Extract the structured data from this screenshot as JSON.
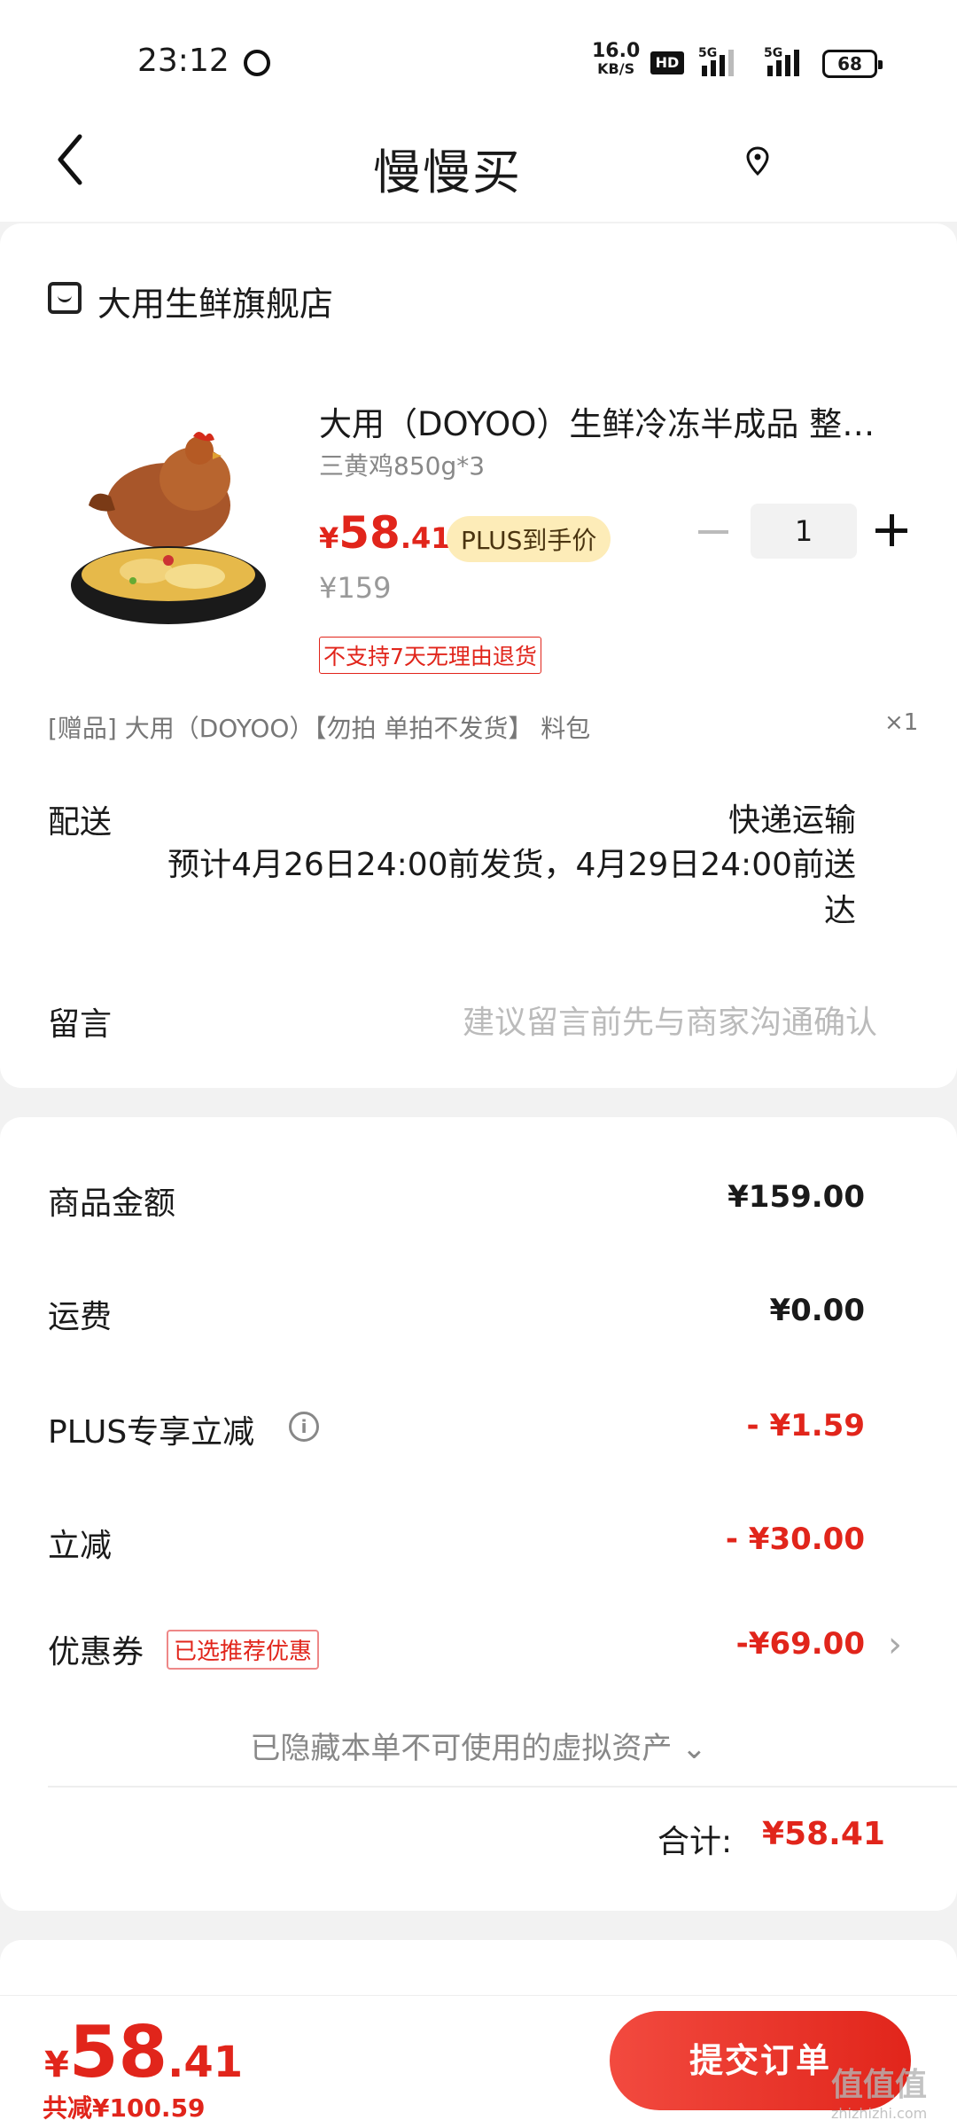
{
  "status": {
    "time": "23:12",
    "speed": "16.0",
    "speed_unit": "KB/S",
    "hd": "HD",
    "net1": "5G",
    "net2": "5G",
    "battery": "68"
  },
  "nav": {
    "title": "慢慢买"
  },
  "shop": {
    "name": "大用生鲜旗舰店"
  },
  "product": {
    "title": "大用（DOYOO）生鲜冷冻半成品 整只装 三黄鸡",
    "spec": "三黄鸡850g*3",
    "price_currency": "¥",
    "price_int": "58",
    "price_dec": ".41",
    "plus_badge": "PLUS到手价",
    "original_price": "¥159",
    "no_return": "不支持7天无理由退货",
    "quantity": "1"
  },
  "gift": {
    "text": "[赠品]  大用（DOYOO）【勿拍 单拍不发货】 料包",
    "qty": "×1"
  },
  "shipping": {
    "label": "配送",
    "method": "快递运输",
    "estimate": "预计4月26日24:00前发货，4月29日24:00前送达"
  },
  "message": {
    "label": "留言",
    "placeholder": "建议留言前先与商家沟通确认"
  },
  "summary": {
    "goods_label": "商品金额",
    "goods_value": "¥159.00",
    "freight_label": "运费",
    "freight_value": "¥0.00",
    "plus_label": "PLUS专享立减",
    "plus_value": "- ¥1.59",
    "discount_label": "立减",
    "discount_value": "- ¥30.00",
    "coupon_label": "优惠券",
    "coupon_tag": "已选推荐优惠",
    "coupon_value": "-¥69.00",
    "hidden_assets": "已隐藏本单不可使用的虚拟资产 ⌄",
    "total_label": "合计:",
    "total_value": "¥58.41"
  },
  "bottom": {
    "currency": "¥",
    "price_int": "58",
    "price_dec": ".41",
    "saved": "共减¥100.59",
    "submit_label": "提交订单"
  },
  "watermark": {
    "text": "值值值",
    "sub": "zhizhizhi.com"
  },
  "colors": {
    "accent": "#e1251b",
    "plus_badge_bg": "#fdecb8"
  }
}
